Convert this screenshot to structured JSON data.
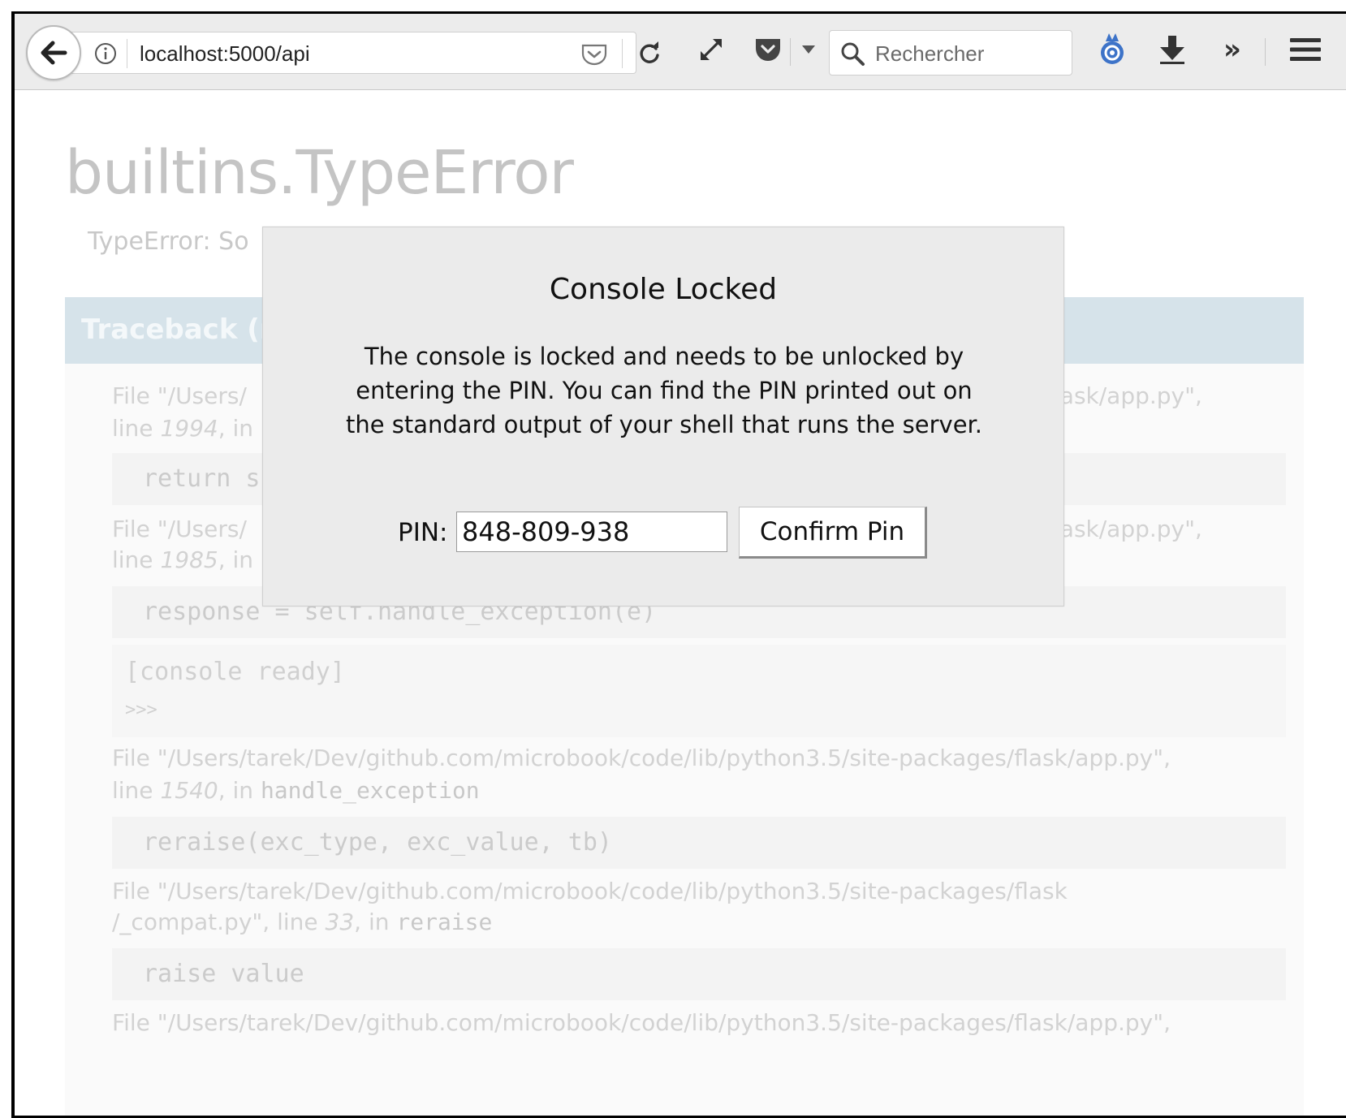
{
  "browser": {
    "url": "localhost:5000/api",
    "search_placeholder": "Rechercher"
  },
  "icons": {
    "back": "back-arrow-icon",
    "info": "info-icon",
    "reader": "reader-view-icon",
    "reload": "reload-icon",
    "expand": "expand-icon",
    "pocket": "pocket-icon",
    "dropdown": "chevron-down-icon",
    "search": "search-icon",
    "extension": "extension-icon",
    "download": "download-icon",
    "overflow": "overflow-chevrons-icon",
    "menu": "hamburger-menu-icon"
  },
  "error": {
    "title": "builtins.TypeError",
    "subtitle": "TypeError: So"
  },
  "traceback": {
    "title": "Traceback (m",
    "frames": [
      {
        "file_prefix": "File \"/Users/",
        "file_suffix": "lask/app.py\",",
        "line_word": "line ",
        "line_num": "1994",
        "line_rest": ", in",
        "code": "return s"
      },
      {
        "file_prefix": "File \"/Users/",
        "file_suffix": "lask/app.py\",",
        "line_word": "line ",
        "line_num": "1985",
        "line_rest": ", in",
        "code": "response = self.handle_exception(e)"
      },
      {
        "file": "File \"/Users/tarek/Dev/github.com/microbook/code/lib/python3.5/site-packages/flask/app.py\",",
        "line_word": "line ",
        "line_num": "1540",
        "line_rest": ", in ",
        "fn": "handle_exception",
        "code": "reraise(exc_type, exc_value, tb)"
      },
      {
        "file": "File \"/Users/tarek/Dev/github.com/microbook/code/lib/python3.5/site-packages/flask",
        "file_line2": "/_compat.py\", line ",
        "line_num": "33",
        "line_rest": ", in ",
        "fn": "reraise",
        "code": "raise value"
      },
      {
        "file": "File \"/Users/tarek/Dev/github.com/microbook/code/lib/python3.5/site-packages/flask/app.py\","
      }
    ],
    "console_ready": "[console ready]",
    "console_prompt": ">>>"
  },
  "modal": {
    "title": "Console Locked",
    "text": "The console is locked and needs to be unlocked by entering the PIN. You can find the PIN printed out on the standard output of your shell that runs the server.",
    "pin_label": "PIN:",
    "pin_value": "848-809-938",
    "confirm_label": "Confirm Pin"
  }
}
